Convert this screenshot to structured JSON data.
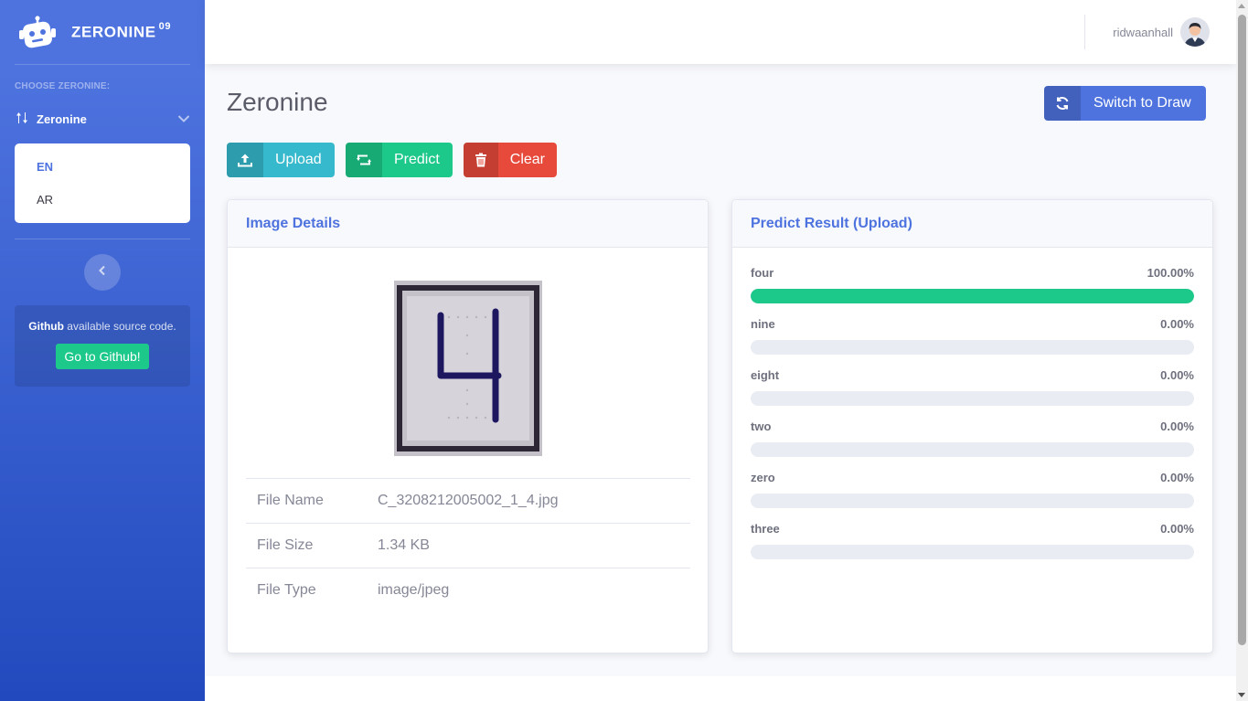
{
  "brand": {
    "name": "ZERONINE",
    "sup": "09"
  },
  "sidebar": {
    "heading": "CHOOSE ZERONINE:",
    "nav_label": "Zeronine",
    "languages": [
      "EN",
      "AR"
    ],
    "card_bold": "Github",
    "card_text": " available source code.",
    "github_button": "Go to Github!"
  },
  "topbar": {
    "username": "ridwaanhall"
  },
  "page": {
    "title": "Zeronine",
    "switch_button": "Switch to Draw",
    "upload_button": "Upload",
    "predict_button": "Predict",
    "clear_button": "Clear"
  },
  "image_details": {
    "title": "Image Details",
    "rows": [
      {
        "label": "File Name",
        "value": "C_3208212005002_1_4.jpg"
      },
      {
        "label": "File Size",
        "value": "1.34 KB"
      },
      {
        "label": "File Type",
        "value": "image/jpeg"
      }
    ]
  },
  "predict": {
    "title": "Predict Result (Upload)",
    "results": [
      {
        "label": "four",
        "percent": "100.00%",
        "value": 100
      },
      {
        "label": "nine",
        "percent": "0.00%",
        "value": 0
      },
      {
        "label": "eight",
        "percent": "0.00%",
        "value": 0
      },
      {
        "label": "two",
        "percent": "0.00%",
        "value": 0
      },
      {
        "label": "zero",
        "percent": "0.00%",
        "value": 0
      },
      {
        "label": "three",
        "percent": "0.00%",
        "value": 0
      }
    ]
  },
  "colors": {
    "primary": "#4e73df",
    "success": "#1cc88a",
    "info": "#36b9cc",
    "danger": "#e74a3b"
  },
  "icons": {
    "brand": "robot-icon",
    "nav": "sort-arrows-icon",
    "chevron": "chevron-down-icon",
    "toggle": "chevron-left-icon",
    "switch": "sync-icon",
    "upload": "upload-icon",
    "predict": "retweet-icon",
    "clear": "trash-icon"
  }
}
